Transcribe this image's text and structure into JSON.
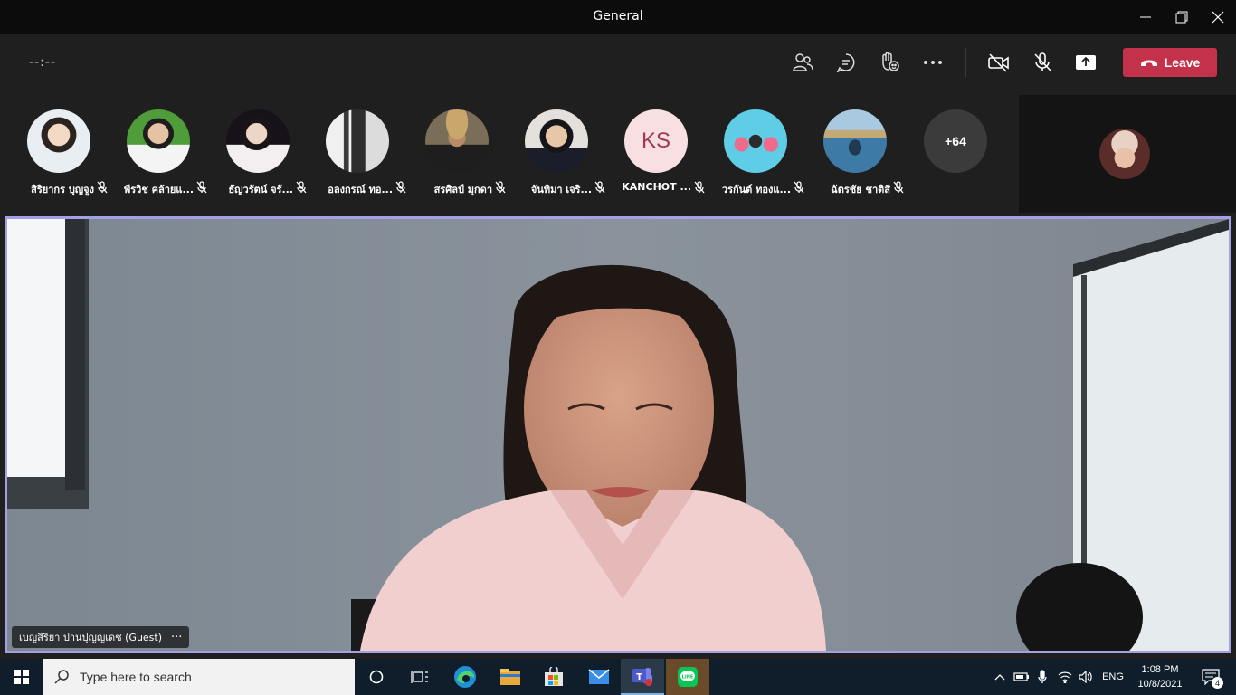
{
  "window": {
    "title": "General"
  },
  "call": {
    "timer": "--:--",
    "leave_label": "Leave"
  },
  "participants": [
    {
      "name": "สิริยากร บุญจูง"
    },
    {
      "name": "พีรวิช คล้ายแ..."
    },
    {
      "name": "ธัญวรัตน์ จรั..."
    },
    {
      "name": "อลงกรณ์ ทอ..."
    },
    {
      "name": "สรศิลป์ มุกดา"
    },
    {
      "name": "จันทิมา เจริ..."
    },
    {
      "name": "KANCHOT ...",
      "initials": "KS"
    },
    {
      "name": "วรกันต์ ทองแ..."
    },
    {
      "name": "ฉัตรชัย ชาติสี"
    }
  ],
  "overflow_count": "+64",
  "stage": {
    "speaker_name": "เบญสิริยา ปานปุญญเดช (Guest)",
    "more_glyph": "···"
  },
  "taskbar": {
    "search_placeholder": "Type here to search",
    "language": "ENG",
    "time": "1:08 PM",
    "date": "10/8/2021",
    "notification_count": "4"
  },
  "colors": {
    "accent": "#a3a0e8",
    "leave": "#c4314b",
    "titlebar": "#0c0c0c",
    "taskbar": "#0f1e2a"
  }
}
